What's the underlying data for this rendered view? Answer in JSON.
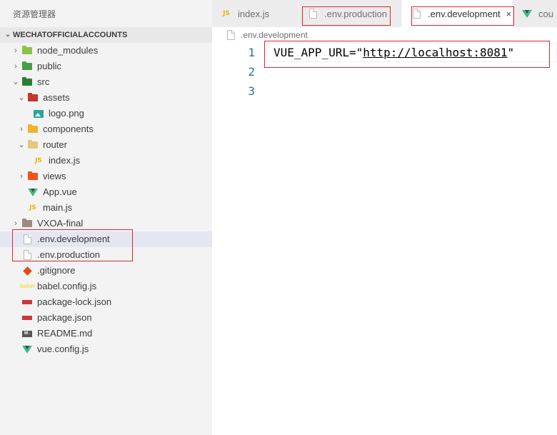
{
  "sidebar": {
    "title": "资源管理器",
    "project": "WECHATOFFICIALACCOUNTS",
    "items": [
      {
        "label": "node_modules",
        "depth": 0,
        "twisty": "›",
        "icon": "folder-node-icon",
        "color": "#8bc34a"
      },
      {
        "label": "public",
        "depth": 0,
        "twisty": "›",
        "icon": "folder-public-icon",
        "color": "#43a047"
      },
      {
        "label": "src",
        "depth": 0,
        "twisty": "⌄",
        "icon": "folder-src-icon",
        "color": "#2e7d32"
      },
      {
        "label": "assets",
        "depth": 1,
        "twisty": "⌄",
        "icon": "folder-assets-icon",
        "color": "#c0392b"
      },
      {
        "label": "logo.png",
        "depth": 2,
        "twisty": "",
        "icon": "image-icon",
        "color": "#26a69a"
      },
      {
        "label": "components",
        "depth": 1,
        "twisty": "›",
        "icon": "folder-components-icon",
        "color": "#f0b429"
      },
      {
        "label": "router",
        "depth": 1,
        "twisty": "⌄",
        "icon": "folder-router-icon",
        "color": "#e8c57a"
      },
      {
        "label": "index.js",
        "depth": 2,
        "twisty": "",
        "icon": "js-icon",
        "color": "#e8b50c"
      },
      {
        "label": "views",
        "depth": 1,
        "twisty": "›",
        "icon": "folder-views-icon",
        "color": "#f4511e"
      },
      {
        "label": "App.vue",
        "depth": 1,
        "twisty": "",
        "icon": "vue-icon",
        "color": "#41b883"
      },
      {
        "label": "main.js",
        "depth": 1,
        "twisty": "",
        "icon": "js-icon",
        "color": "#e8b50c"
      },
      {
        "label": "VXOA-final",
        "depth": 0,
        "twisty": "›",
        "icon": "folder-icon",
        "color": "#a1887f"
      },
      {
        "label": ".env.development",
        "depth": 0,
        "twisty": "",
        "icon": "file-icon",
        "color": "#b7b7b7",
        "selected": true
      },
      {
        "label": ".env.production",
        "depth": 0,
        "twisty": "",
        "icon": "file-icon",
        "color": "#b7b7b7"
      },
      {
        "label": ".gitignore",
        "depth": 0,
        "twisty": "",
        "icon": "git-icon",
        "color": "#e64a19"
      },
      {
        "label": "babel.config.js",
        "depth": 0,
        "twisty": "",
        "icon": "babel-icon",
        "color": "#f5da55"
      },
      {
        "label": "package-lock.json",
        "depth": 0,
        "twisty": "",
        "icon": "npm-icon",
        "color": "#cb3837"
      },
      {
        "label": "package.json",
        "depth": 0,
        "twisty": "",
        "icon": "npm-icon",
        "color": "#cb3837"
      },
      {
        "label": "README.md",
        "depth": 0,
        "twisty": "",
        "icon": "markdown-icon",
        "color": "#555555"
      },
      {
        "label": "vue.config.js",
        "depth": 0,
        "twisty": "",
        "icon": "vue-icon",
        "color": "#41b883"
      }
    ]
  },
  "tabs": [
    {
      "label": "index.js",
      "icon": "js-icon",
      "active": false
    },
    {
      "label": ".env.production",
      "icon": "file-icon",
      "active": false
    },
    {
      "label": ".env.development",
      "icon": "file-icon",
      "active": true,
      "close": "×"
    },
    {
      "label": "cou",
      "icon": "vue-icon",
      "active": false
    }
  ],
  "breadcrumb": {
    "label": ".env.development"
  },
  "editor": {
    "lines": [
      {
        "number": "1",
        "key": "VUE_APP_URL=\"",
        "url": "http://localhost:8081",
        "suffix": "\""
      },
      {
        "number": "2",
        "key": "",
        "url": "",
        "suffix": ""
      },
      {
        "number": "3",
        "key": "",
        "url": "",
        "suffix": ""
      }
    ]
  },
  "icons": {
    "js_text": "JS",
    "md_text": "M↓",
    "babel_text": "babel"
  },
  "colors": {
    "highlight": "#e0242b",
    "line_number": "#237893",
    "selected": "#e4e6f1"
  }
}
